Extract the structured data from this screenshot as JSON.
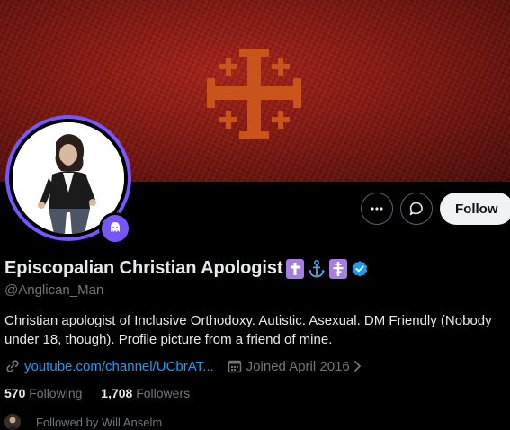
{
  "profile": {
    "name": "Episcopalian Christian Apologist",
    "name_emojis": [
      "latin-cross",
      "anchor",
      "orthodox-cross"
    ],
    "verified": true,
    "handle": "@Anglican_Man",
    "bio": "Christian apologist of Inclusive Orthodoxy. Autistic. Asexual. DM Friendly (Nobody under 18, though). Profile picture from a friend of mine.",
    "link_text": "youtube.com/channel/UCbrAT...",
    "joined": "Joined April 2016",
    "following_count": "570",
    "following_label": "Following",
    "followers_count": "1,708",
    "followers_label": "Followers",
    "followed_by": "Followed by Will Anselm"
  },
  "actions": {
    "more_icon": "more-horizontal-icon",
    "message_icon": "message-icon",
    "follow_label": "Follow"
  },
  "icons": {
    "link": "link-icon",
    "calendar": "calendar-icon",
    "chevron": "chevron-right-icon",
    "badge": "subscriber-badge-icon"
  },
  "colors": {
    "banner": "#8c1a12",
    "cross": "#c8541c",
    "accent_purple": "#7856ff",
    "link_blue": "#1d9bf0",
    "muted": "#71767b"
  }
}
